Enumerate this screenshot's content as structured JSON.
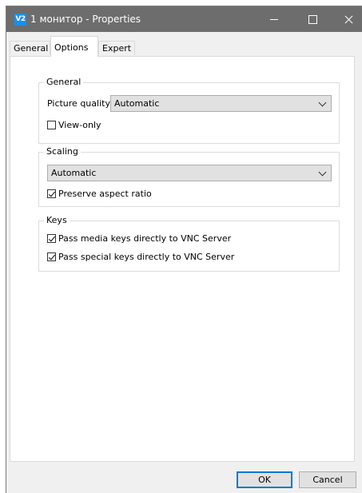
{
  "window": {
    "title": "1 монитор - Properties",
    "icon_label": "V2"
  },
  "tabs": [
    {
      "label": "General",
      "active": false
    },
    {
      "label": "Options",
      "active": true
    },
    {
      "label": "Expert",
      "active": false
    }
  ],
  "general_group": {
    "legend": "General",
    "picture_quality_label": "Picture quality:",
    "picture_quality_value": "Automatic",
    "view_only_label": "View-only",
    "view_only_checked": false
  },
  "scaling_group": {
    "legend": "Scaling",
    "scaling_value": "Automatic",
    "preserve_aspect_label": "Preserve aspect ratio",
    "preserve_aspect_checked": true
  },
  "keys_group": {
    "legend": "Keys",
    "media_keys_label": "Pass media keys directly to VNC Server",
    "media_keys_checked": true,
    "special_keys_label": "Pass special keys directly to VNC Server",
    "special_keys_checked": true
  },
  "buttons": {
    "ok": "OK",
    "cancel": "Cancel"
  },
  "colors": {
    "titlebar": "#6d6d6d",
    "accent": "#0078d7",
    "icon": "#1d8ee6"
  }
}
